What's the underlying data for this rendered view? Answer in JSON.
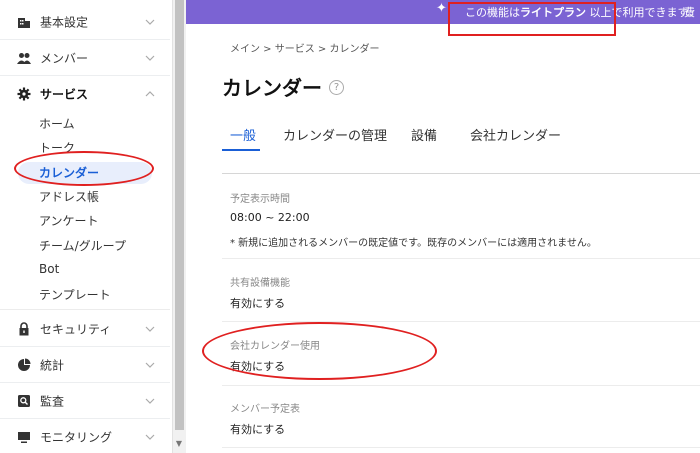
{
  "banner": {
    "prefix": "この機能は",
    "plan": "ライトプラン",
    "suffix": " 以上で利用できます。",
    "extra": "費"
  },
  "sidebar": {
    "groups": [
      {
        "label": "基本設定",
        "icon": "building-icon"
      },
      {
        "label": "メンバー",
        "icon": "members-icon"
      },
      {
        "label": "サービス",
        "icon": "gear-icon",
        "expanded": true
      },
      {
        "label": "セキュリティ",
        "icon": "lock-icon"
      },
      {
        "label": "統計",
        "icon": "pie-chart-icon"
      },
      {
        "label": "監査",
        "icon": "audit-icon"
      },
      {
        "label": "モニタリング",
        "icon": "monitor-icon"
      }
    ],
    "service_items": [
      "ホーム",
      "トーク",
      "カレンダー",
      "アドレス帳",
      "アンケート",
      "チーム/グループ",
      "Bot",
      "テンプレート"
    ],
    "active_item": "カレンダー"
  },
  "breadcrumb": "メイン > サービス > カレンダー",
  "page_title": "カレンダー",
  "help_symbol": "?",
  "tabs": [
    "一般",
    "カレンダーの管理",
    "設備",
    "会社カレンダー"
  ],
  "active_tab": "一般",
  "settings": [
    {
      "label": "予定表示時間",
      "value": "08:00 ~ 22:00",
      "note": "* 新規に追加されるメンバーの既定値です。既存のメンバーには適用されません。"
    },
    {
      "label": "共有設備機能",
      "value": "有効にする"
    },
    {
      "label": "会社カレンダー使用",
      "value": "有効にする"
    },
    {
      "label": "メンバー予定表",
      "value": "有効にする"
    }
  ],
  "colors": {
    "banner": "#7b63d3",
    "accent": "#1a5fd6",
    "annotation": "#e02020"
  }
}
